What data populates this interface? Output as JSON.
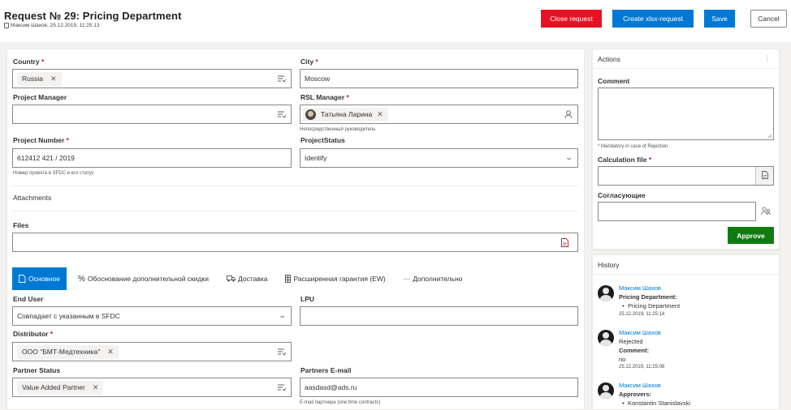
{
  "header": {
    "title": "Request № 29: Pricing Department",
    "meta": "Максим Шахов, 25.12.2019, 11:25:13",
    "close_label": "Close request",
    "xlsx_label": "Create xlsx-request",
    "save_label": "Save",
    "cancel_label": "Cancel",
    "accent_color": "#0078d4",
    "danger_color": "#e81123"
  },
  "form": {
    "country": {
      "label": "Country",
      "value": "Russia"
    },
    "city": {
      "label": "City",
      "value": "Moscow"
    },
    "project_manager": {
      "label": "Project Manager",
      "value": ""
    },
    "rsl_manager": {
      "label": "RSL Manager",
      "value": "Татьяна Ларина",
      "hint": "Непосредственный руководитель"
    },
    "project_number": {
      "label": "Project Number",
      "value": "612412 421 / 2019",
      "hint": "Номер проекта в SFDC и его статус"
    },
    "project_status": {
      "label": "ProjectStatus",
      "value": "Identify"
    },
    "attachments_title": "Attachments",
    "files_label": "Files",
    "tabs": [
      {
        "label": "Основное",
        "icon": "document-icon"
      },
      {
        "label": "Обоснование дополнительной скидки",
        "icon": "percent-icon"
      },
      {
        "label": "Доставка",
        "icon": "truck-icon"
      },
      {
        "label": "Расширенная гарантия (EW)",
        "icon": "grid-icon"
      },
      {
        "label": "Дополнительно",
        "icon": "more-icon"
      }
    ],
    "end_user": {
      "label": "End User",
      "value": "Совпадает с указанным в SFDC"
    },
    "lpu": {
      "label": "LPU",
      "value": ""
    },
    "distributor": {
      "label": "Distributor",
      "value": "ООО \"БМТ-Медтехника\""
    },
    "partner_status": {
      "label": "Partner Status",
      "value": "Value Added Partner"
    },
    "partners_email": {
      "label": "Partners E-mail",
      "value": "aasdasd@ads.ru",
      "hint": "E-mail партнера (one time contracts)"
    },
    "required_mark": "*"
  },
  "actions": {
    "title": "Actions",
    "more": "⋮",
    "comment_label": "Comment",
    "comment_hint": "* Mandatory in case of Rejection",
    "calc_label": "Calculation file",
    "approvers_label": "Согласующие",
    "approve_label": "Approve",
    "approve_color": "#107c10"
  },
  "history": {
    "title": "History",
    "entries": [
      {
        "name": "Максим Шахов",
        "line1": "Pricing Department:",
        "bullet": "Pricing Department",
        "time": "25.12.2019, 11:25:14"
      },
      {
        "name": "Максим Шахов",
        "line1": "Rejected",
        "line2": "Comment:",
        "line3": "no",
        "time": "25.12.2019, 11:25:08"
      },
      {
        "name": "Максим Шахов",
        "line1": "Approvers:",
        "bullet": "Konstantin Stanislavski"
      }
    ]
  }
}
